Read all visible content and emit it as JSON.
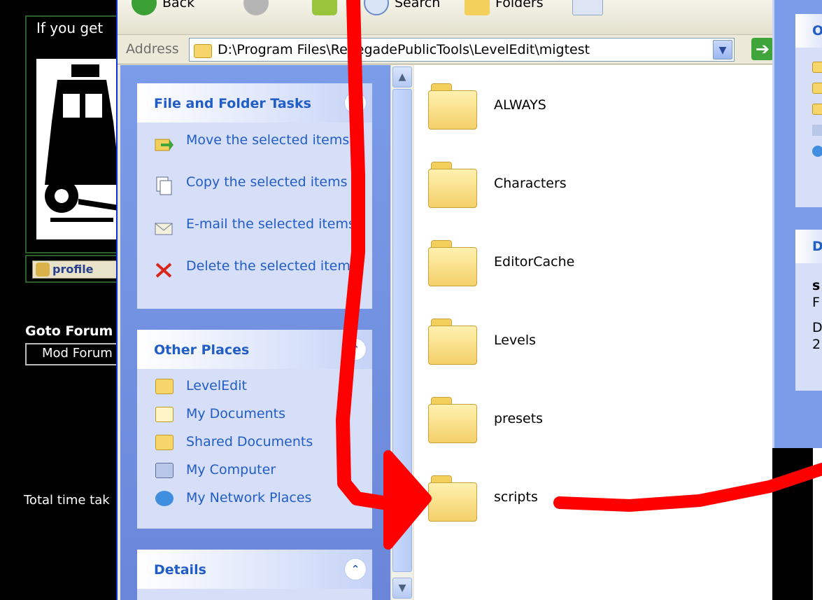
{
  "forum": {
    "image_caption": "If you get",
    "profile_label": "profile",
    "goto_label": "Goto Forum",
    "forum_select_value": "Mod Forum",
    "footer_text": "Total time tak"
  },
  "toolbar": {
    "back_label": "Back",
    "search_label": "Search",
    "folders_label": "Folders"
  },
  "address": {
    "label": "Address",
    "value": "D:\\Program Files\\RenegadePublicTools\\LevelEdit\\migtest"
  },
  "task_pane": {
    "file_tasks": {
      "title": "File and Folder Tasks",
      "items": [
        {
          "label": "Move the selected items",
          "icon": "move-icon"
        },
        {
          "label": "Copy the selected items",
          "icon": "copy-icon"
        },
        {
          "label": "E-mail the selected items",
          "icon": "email-icon"
        },
        {
          "label": "Delete the selected items",
          "icon": "delete-icon"
        }
      ]
    },
    "other_places": {
      "title": "Other Places",
      "items": [
        {
          "label": "LevelEdit",
          "icon": "folder-icon"
        },
        {
          "label": "My Documents",
          "icon": "my-documents-icon"
        },
        {
          "label": "Shared Documents",
          "icon": "folder-icon"
        },
        {
          "label": "My Computer",
          "icon": "my-computer-icon"
        },
        {
          "label": "My Network Places",
          "icon": "network-icon"
        }
      ]
    },
    "details": {
      "title": "Details"
    }
  },
  "files": [
    {
      "name": "ALWAYS"
    },
    {
      "name": "Characters"
    },
    {
      "name": "EditorCache"
    },
    {
      "name": "Levels"
    },
    {
      "name": "presets"
    },
    {
      "name": "scripts"
    }
  ],
  "right_pane": {
    "box1_head": "O",
    "box2_head": "D",
    "box2_lines": [
      "s",
      "F",
      "D",
      "2"
    ]
  },
  "colors": {
    "task_link": "#215dc6",
    "annotation": "#ff0000",
    "pane_bg": "#7b9ce8"
  }
}
